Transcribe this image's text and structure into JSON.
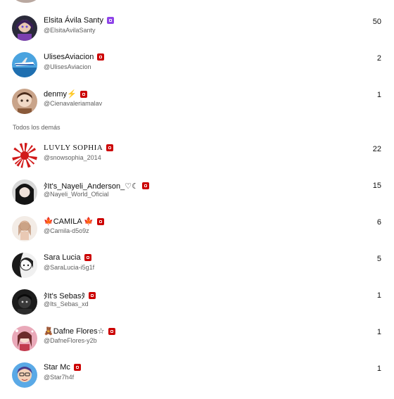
{
  "section_label": "Todos los demás",
  "colors": {
    "youtube_badge": "#cc0000",
    "member_badge": "#8e44e8"
  },
  "top_rows": [
    {
      "name": "Elsita Ávila Santy",
      "handle": "@ElsitaAvilaSanty",
      "count": "50",
      "badge": "member-badge-icon"
    },
    {
      "name": "UlisesAviacion",
      "handle": "@UlisesAviacion",
      "count": "2",
      "badge": "play-badge-icon"
    },
    {
      "name": "denmy⚡",
      "handle": "@Cienavaleriamalav",
      "count": "1",
      "badge": "play-badge-icon"
    }
  ],
  "other_rows": [
    {
      "name": "LUVLY SOPHIA",
      "handle": "@snowsophia_2014",
      "count": "22",
      "badge": "play-badge-icon"
    },
    {
      "name": "ﾀIt's_Nayeli_Anderson_♡☾",
      "handle": "@Nayeli_World_Oficial",
      "count": "15",
      "badge": "play-badge-icon"
    },
    {
      "name": "🍁CAMILA 🍁",
      "handle": "@Camila-d5o9z",
      "count": "6",
      "badge": "play-badge-icon"
    },
    {
      "name": "Sara Lucia",
      "handle": "@SaraLucia-i5g1f",
      "count": "5",
      "badge": "play-badge-icon"
    },
    {
      "name": "ﾀIt's Sebasﾀ",
      "handle": "@Its_Sebas_xd",
      "count": "1",
      "badge": "play-badge-icon"
    },
    {
      "name": "🧸Dafne Flores☆",
      "handle": "@DafneFlores-y2b",
      "count": "1",
      "badge": "play-badge-icon"
    },
    {
      "name": "Star Mc",
      "handle": "@Star7h4f",
      "count": "1",
      "badge": "play-badge-icon"
    }
  ]
}
